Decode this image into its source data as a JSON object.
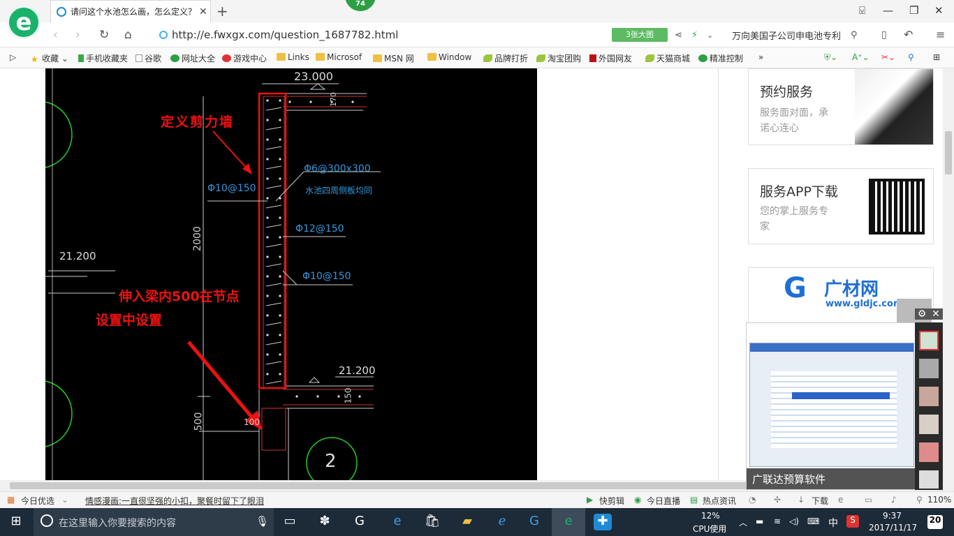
{
  "browser": {
    "tab_title": "请问这个水池怎么画，怎么定义？",
    "tab_close": "✕",
    "new_tab": "+",
    "badge": "74",
    "url": "http://e.fwxgx.com/question_1687782.html",
    "zoom_label": "3张大图",
    "search_text": "万向美国子公司申电池专利",
    "window_controls": [
      "⚲",
      "—",
      "❐",
      "✕"
    ]
  },
  "bookmarks": [
    {
      "label": "收藏",
      "icon": "star-icon"
    },
    {
      "label": "手机收藏夹",
      "icon": "phone-icon"
    },
    {
      "label": "谷歌",
      "icon": "page-icon"
    },
    {
      "label": "网址大全",
      "icon": "globe-icon"
    },
    {
      "label": "游戏中心",
      "icon": "game-icon"
    },
    {
      "label": "Links",
      "icon": "folder-icon"
    },
    {
      "label": "Microsof",
      "icon": "folder-icon"
    },
    {
      "label": "MSN 网",
      "icon": "folder-icon"
    },
    {
      "label": "Window",
      "icon": "folder-icon"
    },
    {
      "label": "品牌打折",
      "icon": "leaf-icon"
    },
    {
      "label": "淘宝团购",
      "icon": "leaf-icon"
    },
    {
      "label": "外国网友",
      "icon": "flag-icon"
    },
    {
      "label": "天猫商城",
      "icon": "leaf-icon"
    },
    {
      "label": "精准控制",
      "icon": "chat-icon"
    }
  ],
  "cad": {
    "dim_top": "23.000",
    "dim_170": "170",
    "define_wall": "定义剪力墙",
    "rebar_1": "Φ6@300x300",
    "rebar_note": "水池四周侧板均同",
    "rebar_2": "Φ10@150",
    "rebar_3": "Φ12@150",
    "rebar_4": "Φ10@150",
    "height": "2000",
    "elev_1": "21.200",
    "elev_2": "21.200",
    "note_1": "伸入梁内500在节点",
    "note_2": "设置中设置",
    "dim_500": "500",
    "dim_100": "100",
    "dim_150": "150",
    "circle_num": "2"
  },
  "sidebar": {
    "card1_title": "预约服务",
    "card1_desc1": "服务面对面，承",
    "card1_desc2": "诺心连心",
    "card2_title": "服务APP下载",
    "card2_desc1": "您的掌上服务专",
    "card2_desc2": "家",
    "ad_brand": "广材网",
    "ad_url": "www.gldjc.com",
    "popup_caption": "广联达预算软件"
  },
  "status_bar": {
    "today": "今日优选",
    "news": "情感漫画:一直很坚强的小扣，聚餐时留下了眼泪",
    "quick_cut": "快剪辑",
    "live": "今日直播",
    "hot": "热点资讯",
    "download": "下载",
    "zoom": "110%"
  },
  "taskbar": {
    "search_placeholder": "在这里输入你要搜索的内容",
    "cpu_percent": "12%",
    "cpu_label": "CPU使用",
    "ime": "中",
    "time": "9:37",
    "date": "2017/11/17",
    "notifications": "20"
  }
}
